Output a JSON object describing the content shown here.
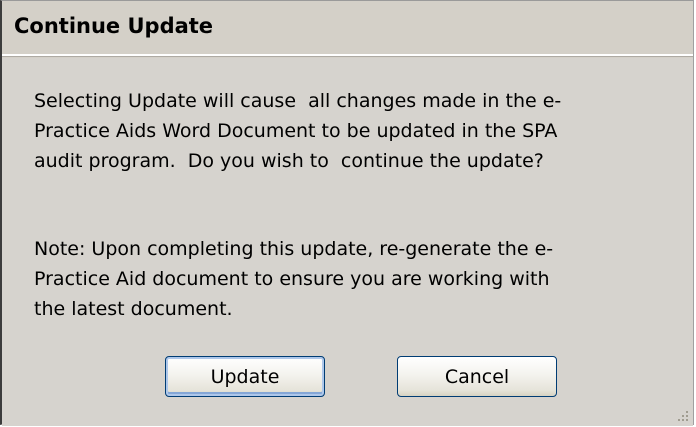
{
  "dialog": {
    "title": "Continue Update",
    "message": "Selecting Update will cause  all changes made in the e-\nPractice Aids Word Document to be updated in the SPA\naudit program.  Do you wish to  continue the update?",
    "note": "Note: Upon completing this update, re-generate the e-\nPractice Aid document to ensure you are working with\nthe latest document.",
    "buttons": {
      "update_label": "Update",
      "cancel_label": "Cancel"
    }
  },
  "colors": {
    "dialog_background": "#d4d0c8",
    "button_border": "#003c74",
    "default_button_focus": "#aec7ea"
  },
  "icons": {
    "resize_grip": "resize-grip-icon"
  }
}
